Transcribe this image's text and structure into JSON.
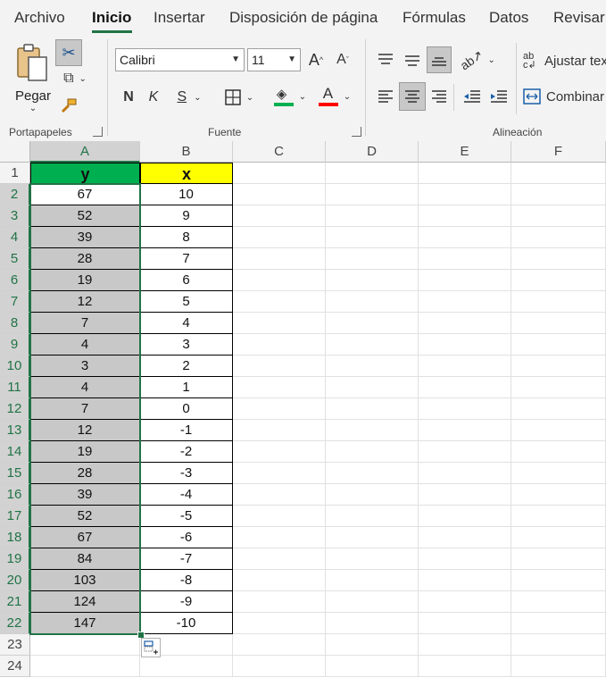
{
  "tabs": [
    "Archivo",
    "Inicio",
    "Insertar",
    "Disposición de página",
    "Fórmulas",
    "Datos",
    "Revisar"
  ],
  "ribbon": {
    "clipboard": {
      "paste_label": "Pegar",
      "group_label": "Portapapeles"
    },
    "font": {
      "font_name": "Calibri",
      "font_size": "11",
      "bold": "N",
      "italic": "K",
      "underline": "S",
      "grow": "A",
      "shrink": "A",
      "font_color_letter": "A",
      "group_label": "Fuente",
      "fill_color": "#00b050",
      "font_color": "#ff0000"
    },
    "alignment": {
      "wrap_text": "Ajustar tex",
      "merge": "Combinar",
      "group_label": "Alineación"
    }
  },
  "grid": {
    "columns": [
      "A",
      "B",
      "C",
      "D",
      "E",
      "F"
    ],
    "rows": [
      "1",
      "2",
      "3",
      "4",
      "5",
      "6",
      "7",
      "8",
      "9",
      "10",
      "11",
      "12",
      "13",
      "14",
      "15",
      "16",
      "17",
      "18",
      "19",
      "20",
      "21",
      "22",
      "23",
      "24"
    ],
    "header_y": "y",
    "header_x": "x",
    "y_values": [
      "67",
      "52",
      "39",
      "28",
      "19",
      "12",
      "7",
      "4",
      "3",
      "4",
      "7",
      "12",
      "19",
      "28",
      "39",
      "52",
      "67",
      "84",
      "103",
      "124",
      "147"
    ],
    "x_values": [
      "10",
      "9",
      "8",
      "7",
      "6",
      "5",
      "4",
      "3",
      "2",
      "1",
      "0",
      "-1",
      "-2",
      "-3",
      "-4",
      "-5",
      "-6",
      "-7",
      "-8",
      "-9",
      "-10"
    ],
    "header_y_color": "#00b050",
    "header_x_color": "#ffff00"
  }
}
